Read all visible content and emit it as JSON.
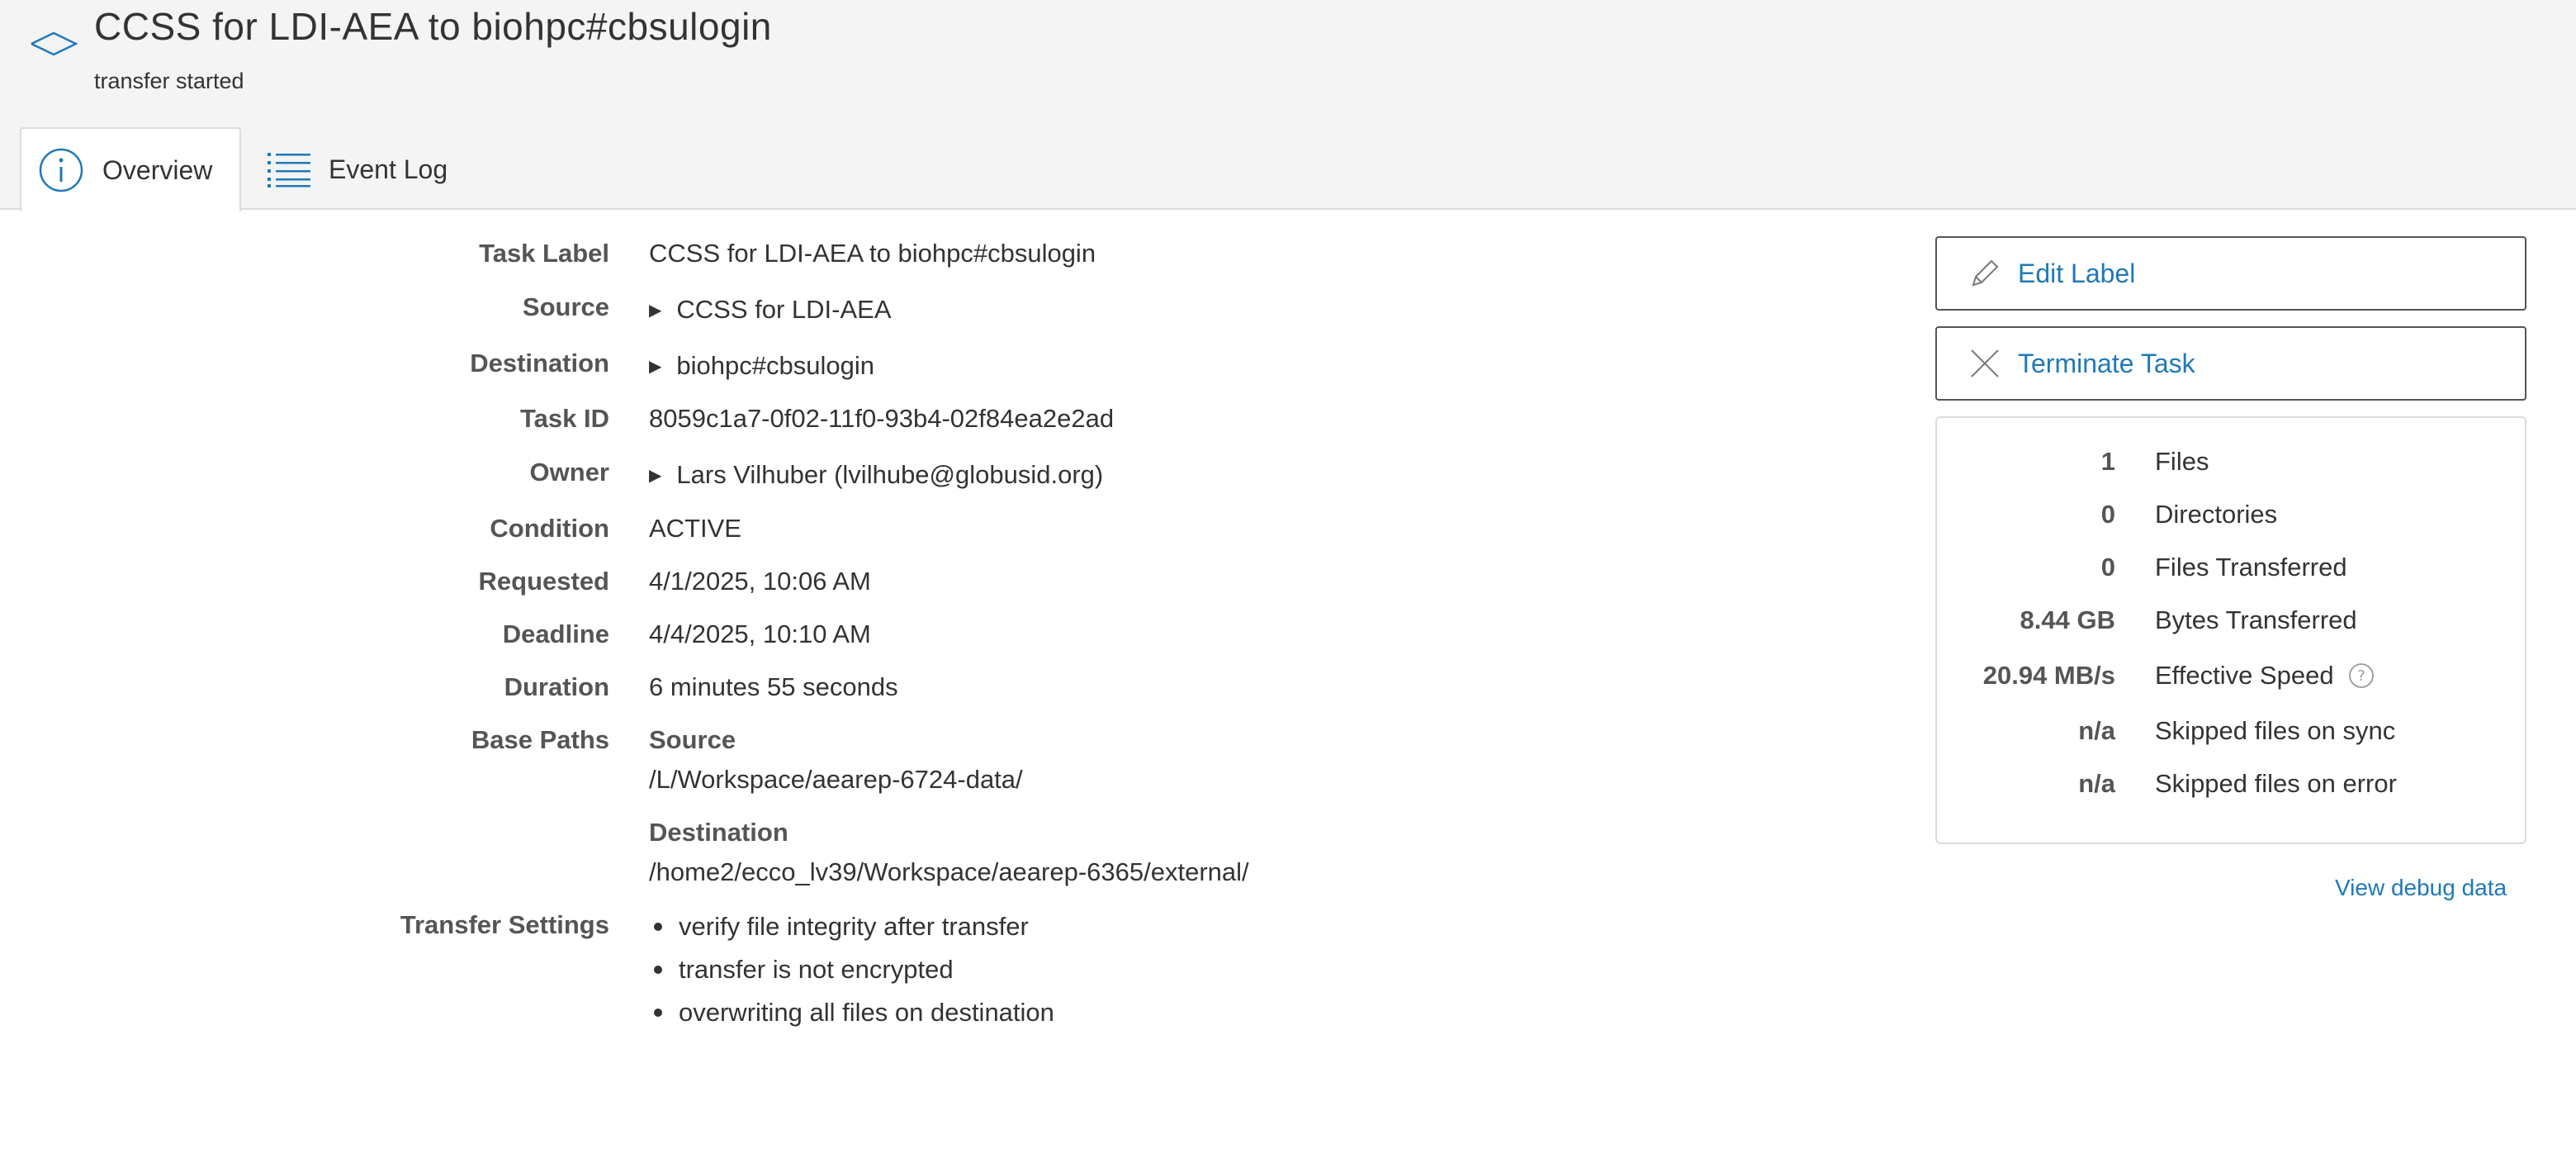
{
  "header": {
    "title": "CCSS for LDI-AEA to biohpc#cbsulogin",
    "subtitle": "transfer started"
  },
  "tabs": [
    {
      "label": "Overview",
      "icon": "info-icon",
      "active": true
    },
    {
      "label": "Event Log",
      "icon": "list-icon",
      "active": false
    }
  ],
  "details": {
    "task_label": {
      "label": "Task Label",
      "value": "CCSS for LDI-AEA to biohpc#cbsulogin"
    },
    "source": {
      "label": "Source",
      "value": "CCSS for LDI-AEA"
    },
    "destination": {
      "label": "Destination",
      "value": "biohpc#cbsulogin"
    },
    "task_id": {
      "label": "Task ID",
      "value": "8059c1a7-0f02-11f0-93b4-02f84ea2e2ad"
    },
    "owner": {
      "label": "Owner",
      "value": "Lars Vilhuber (lvilhube@globusid.org)"
    },
    "condition": {
      "label": "Condition",
      "value": "ACTIVE"
    },
    "requested": {
      "label": "Requested",
      "value": "4/1/2025, 10:06 AM"
    },
    "deadline": {
      "label": "Deadline",
      "value": "4/4/2025, 10:10 AM"
    },
    "duration": {
      "label": "Duration",
      "value": "6 minutes 55 seconds"
    },
    "base_paths": {
      "label": "Base Paths",
      "source_label": "Source",
      "source_path": "/L/Workspace/aearep-6724-data/",
      "destination_label": "Destination",
      "destination_path": "/home2/ecco_lv39/Workspace/aearep-6365/external/"
    },
    "transfer_settings": {
      "label": "Transfer Settings",
      "items": [
        "verify file integrity after transfer",
        "transfer is not encrypted",
        "overwriting all files on destination"
      ]
    }
  },
  "actions": {
    "edit_label": "Edit Label",
    "terminate_task": "Terminate Task"
  },
  "stats": [
    {
      "value": "1",
      "label": "Files"
    },
    {
      "value": "0",
      "label": "Directories"
    },
    {
      "value": "0",
      "label": "Files Transferred"
    },
    {
      "value": "8.44 GB",
      "label": "Bytes Transferred"
    },
    {
      "value": "20.94 MB/s",
      "label": "Effective Speed"
    },
    {
      "value": "n/a",
      "label": "Skipped files on sync"
    },
    {
      "value": "n/a",
      "label": "Skipped files on error"
    }
  ],
  "debug_link": "View debug data",
  "colors": {
    "accent": "#1f79b8",
    "header_bg": "#f4f4f4",
    "label_text": "#555555"
  }
}
